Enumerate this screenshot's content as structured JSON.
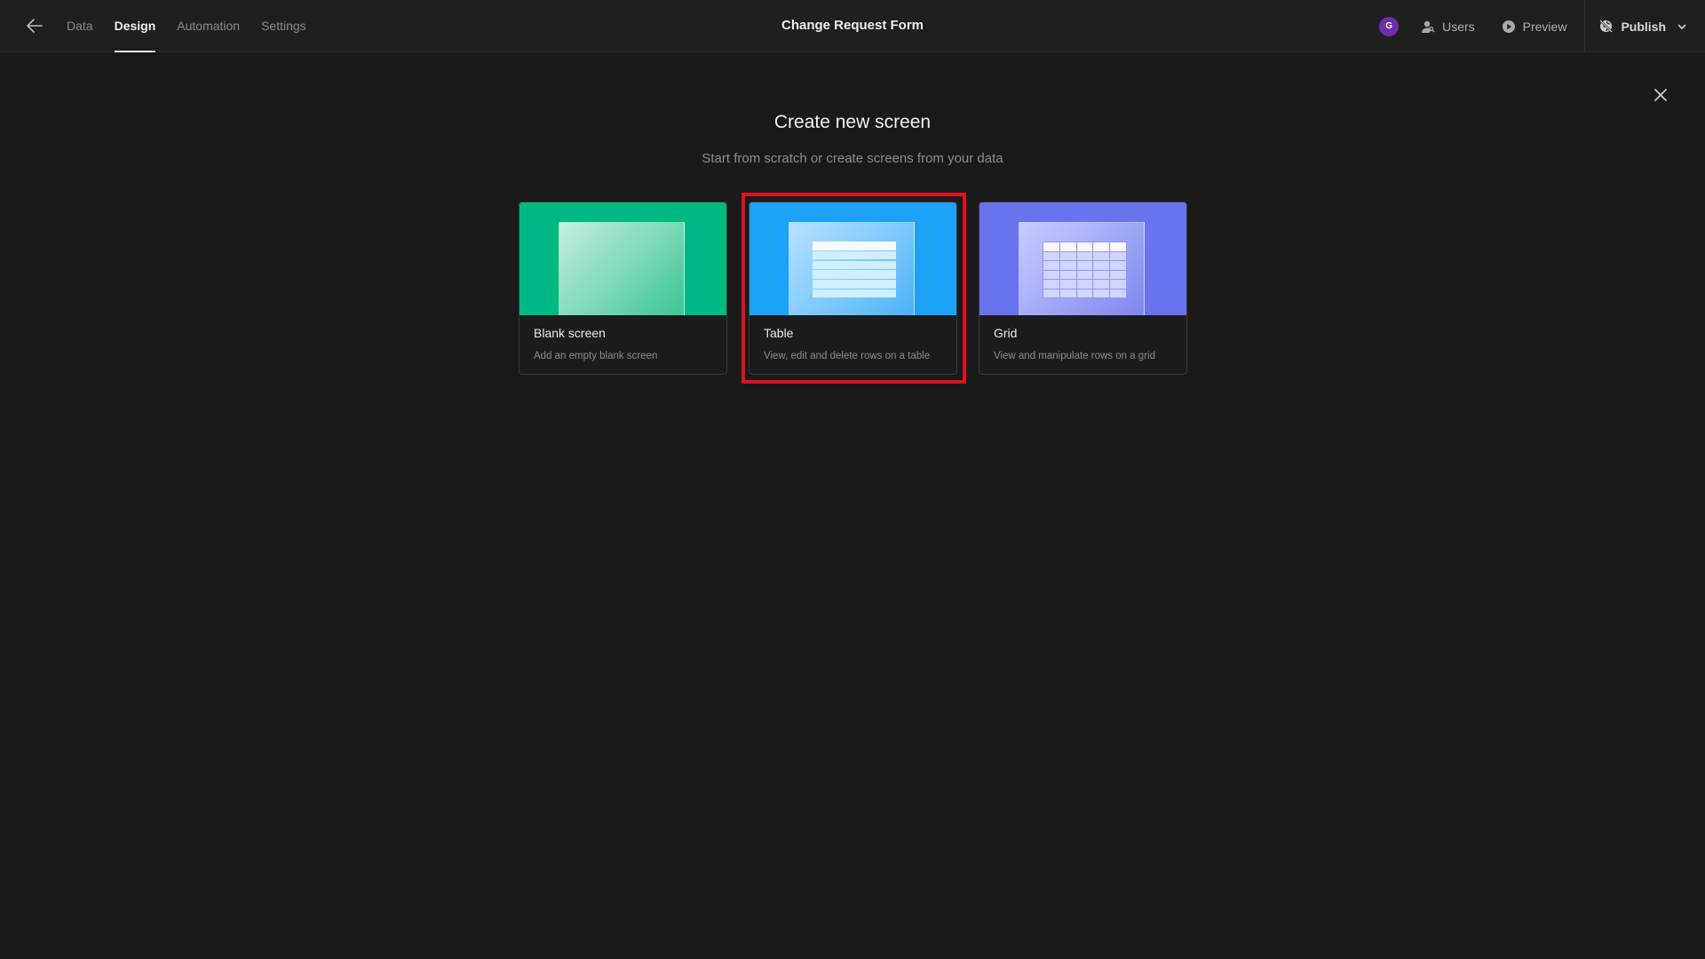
{
  "header": {
    "back_icon": "arrow-left-icon",
    "tabs": [
      {
        "label": "Data",
        "active": false
      },
      {
        "label": "Design",
        "active": true
      },
      {
        "label": "Automation",
        "active": false
      },
      {
        "label": "Settings",
        "active": false
      }
    ],
    "app_title": "Change Request Form",
    "avatar_initial": "G",
    "avatar_color": "#6b2fa8",
    "users_label": "Users",
    "preview_label": "Preview",
    "publish_label": "Publish"
  },
  "modal": {
    "close_icon": "close-icon",
    "title": "Create new screen",
    "subtitle": "Start from scratch or create screens from your data",
    "options": [
      {
        "title": "Blank screen",
        "description": "Add an empty blank screen",
        "color": "#00b884",
        "selected": false
      },
      {
        "title": "Table",
        "description": "View, edit and delete rows on a table",
        "color": "#1ea2f7",
        "selected": true
      },
      {
        "title": "Grid",
        "description": "View and manipulate rows on a grid",
        "color": "#6874ed",
        "selected": false
      }
    ],
    "highlight_color": "#e0101e"
  }
}
